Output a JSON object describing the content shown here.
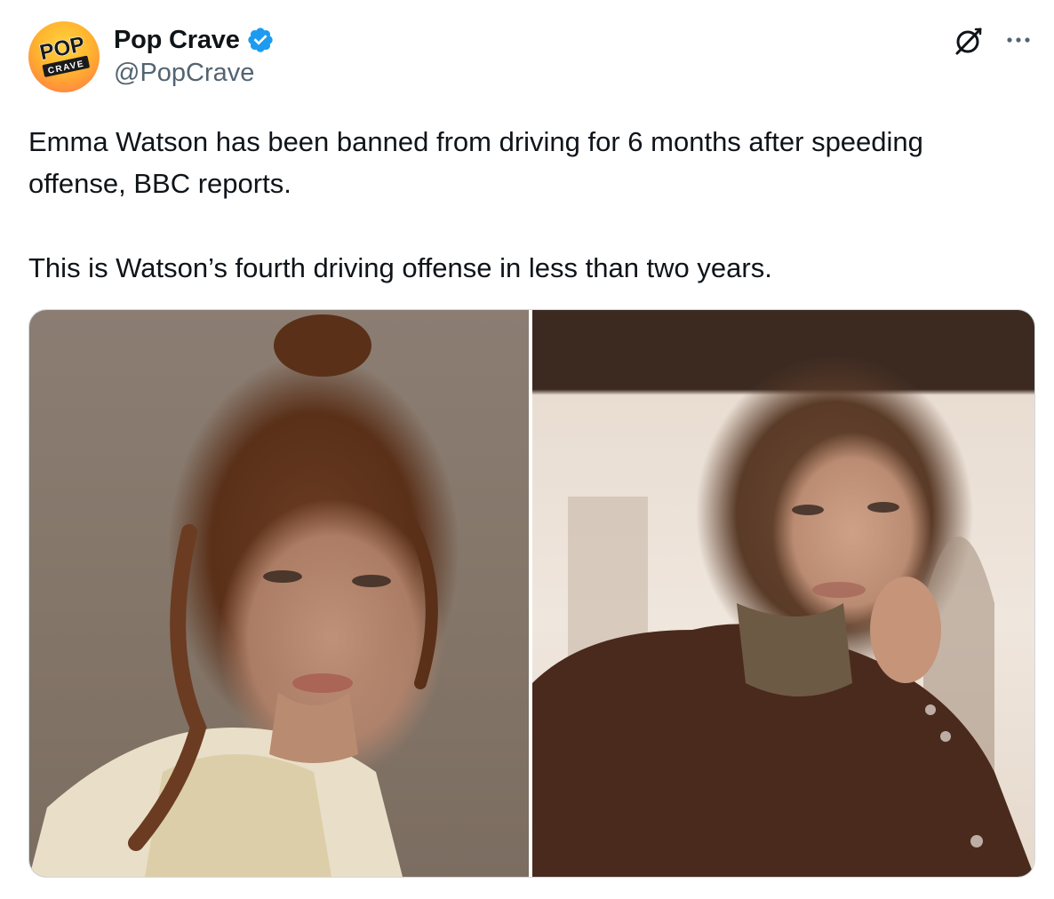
{
  "author": {
    "display_name": "Pop Crave",
    "handle": "@PopCrave",
    "verified": true,
    "avatar_logo_text_top": "POP",
    "avatar_logo_text_bottom": "CRAVE"
  },
  "actions": {
    "grok_icon": "grok-icon",
    "more_icon": "more-icon"
  },
  "tweet": {
    "paragraph_1": "Emma Watson has been banned from driving for 6 months after speeding offense, BBC reports.",
    "paragraph_2": "This is Watson’s fourth driving offense in less than two years."
  },
  "media": {
    "count": 2
  },
  "colors": {
    "verified_blue": "#1d9bf0",
    "text_primary": "#0f1419",
    "text_secondary": "#536471",
    "border": "#cfd9de"
  }
}
